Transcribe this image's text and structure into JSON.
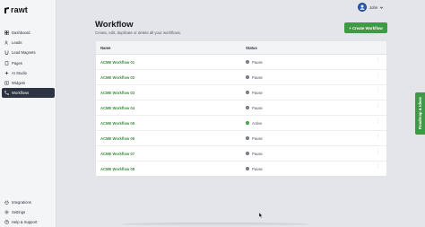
{
  "app": {
    "logo_text": "rawt"
  },
  "sidebar": {
    "items": [
      {
        "label": "Dashboard",
        "icon": "dashboard-icon"
      },
      {
        "label": "Leads",
        "icon": "users-icon"
      },
      {
        "label": "Lead Magnets",
        "icon": "magnet-icon"
      },
      {
        "label": "Pages",
        "icon": "pages-icon"
      },
      {
        "label": "AI Studio",
        "icon": "sparkle-icon"
      },
      {
        "label": "Widgets",
        "icon": "widgets-icon"
      },
      {
        "label": "Workflows",
        "icon": "workflow-icon",
        "active": true
      }
    ],
    "bottom_items": [
      {
        "label": "Integrations",
        "icon": "integrations-icon"
      },
      {
        "label": "Settings",
        "icon": "gear-icon"
      },
      {
        "label": "Help & Support",
        "icon": "help-icon"
      }
    ]
  },
  "header": {
    "title": "Workflow",
    "subtitle": "Create, edit, duplicate or delete all your workflows.",
    "user_name": "John",
    "create_button": "+ Create Workflow"
  },
  "table": {
    "columns": [
      "Name",
      "Status"
    ],
    "rows": [
      {
        "name": "ACME Workflow 01",
        "status": "Pause"
      },
      {
        "name": "ACME Workflow 02",
        "status": "Pause"
      },
      {
        "name": "ACME Workflow 03",
        "status": "Pause"
      },
      {
        "name": "ACME Workflow 04",
        "status": "Pause"
      },
      {
        "name": "ACME Workflow 05",
        "status": "Active"
      },
      {
        "name": "ACME Workflow 06",
        "status": "Pause"
      },
      {
        "name": "ACME Workflow 07",
        "status": "Pause"
      },
      {
        "name": "ACME Workflow 08",
        "status": "Pause"
      }
    ]
  },
  "roadmap_tab": "Roadmap & Ideas",
  "colors": {
    "accent_green": "#3f9a45",
    "sidebar_active": "#2d3340",
    "status_pause": "#8a8f98",
    "status_active": "#57b35c"
  }
}
